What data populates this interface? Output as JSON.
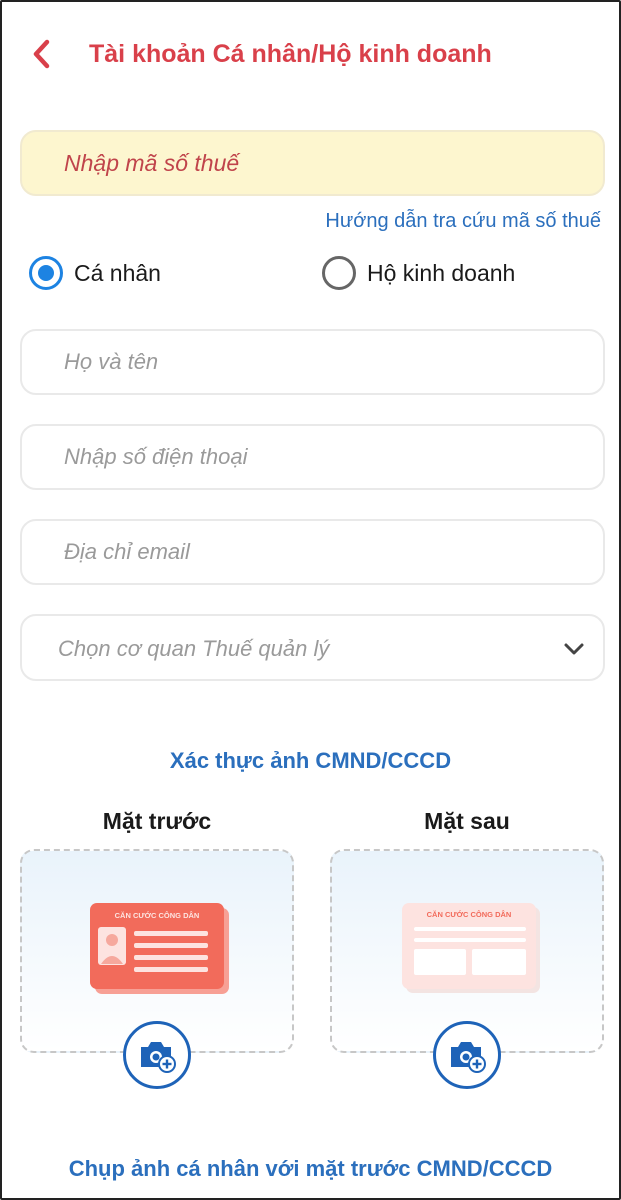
{
  "header": {
    "title": "Tài khoản Cá nhân/Hộ kinh doanh",
    "back_icon": "chevron-left-icon"
  },
  "form": {
    "tax_code_placeholder": "Nhập mã số thuế",
    "guide_link": "Hướng dẫn tra cứu mã số thuế",
    "account_types": [
      {
        "label": "Cá nhân",
        "selected": true
      },
      {
        "label": "Hộ kinh doanh",
        "selected": false
      }
    ],
    "full_name_placeholder": "Họ và tên",
    "phone_placeholder": "Nhập số điện thoại",
    "email_placeholder": "Địa chỉ email",
    "tax_office_placeholder": "Chọn cơ quan Thuế quản lý"
  },
  "id_verification": {
    "title": "Xác thực ảnh CMND/CCCD",
    "front_label": "Mặt trước",
    "back_label": "Mặt sau",
    "card_heading": "CĂN CƯỚC CÔNG DÂN",
    "selfie_link": "Chụp ảnh cá nhân với mặt trước CMND/CCCD"
  },
  "colors": {
    "accent_red": "#d9404a",
    "link_blue": "#2b6fbd",
    "radio_blue": "#1d83e2",
    "tax_input_bg": "#fdf6cf",
    "card_front": "#f26b5b",
    "card_back": "#fde3e0"
  }
}
